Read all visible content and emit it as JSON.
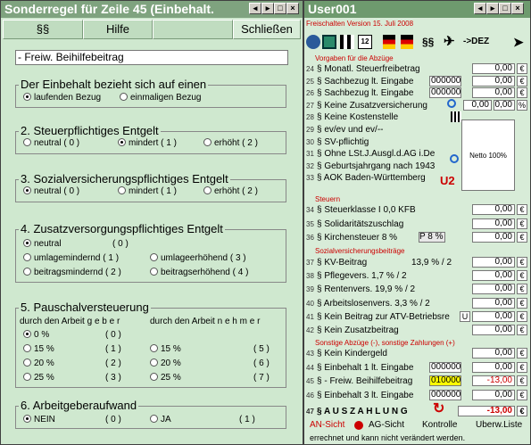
{
  "left": {
    "title": "Sonderregel für Zeile 45 (Einbehalt.",
    "menu": {
      "section": "§§",
      "help": "Hilfe",
      "close": "Schließen"
    },
    "name_field": "- Freiw. Beihilfebeitrag",
    "g1": {
      "title": "Der Einbehalt bezieht sich auf einen",
      "opt1": "laufenden Bezug",
      "opt2": "einmaligen Bezug"
    },
    "g2": {
      "title": "2. Steuerpflichtiges Entgelt",
      "opt1": "neutral",
      "v1": "( 0 )",
      "opt2": "mindert",
      "v2": "( 1 )",
      "opt3": "erhöht",
      "v3": "( 2 )"
    },
    "g3": {
      "title": "3. Sozialversicherungspflichtiges Entgelt",
      "opt1": "neutral",
      "v1": "( 0 )",
      "opt2": "mindert",
      "v2": "( 1 )",
      "opt3": "erhöht",
      "v3": "( 2 )"
    },
    "g4": {
      "title": "4. Zusatzversorgungspflichtiges Entgelt",
      "opt1": "neutral",
      "v1": "( 0 )",
      "opt2": "umlagemindernd",
      "v2": "( 1 )",
      "opt3": "umlageerhöhend",
      "v3": "( 3 )",
      "opt4": "beitragsmindernd",
      "v4": "( 2 )",
      "opt5": "beitragserhöhend",
      "v5": "( 4 )"
    },
    "g5": {
      "title": "5. Pauschalversteuerung",
      "h1": "durch den Arbeit  g e b e r",
      "h2": "durch den Arbeit  n e h m e r",
      "rows": [
        [
          "0 %",
          "( 0 )",
          "",
          ""
        ],
        [
          "15 %",
          "( 1 )",
          "15 %",
          "( 5 )"
        ],
        [
          "20 %",
          "( 2 )",
          "20 %",
          "( 6 )"
        ],
        [
          "25 %",
          "( 3 )",
          "25 %",
          "( 7 )"
        ]
      ]
    },
    "g6": {
      "title": "6. Arbeitgeberaufwand",
      "opt1": "NEIN",
      "v1": "( 0 )",
      "opt2": "JA",
      "v2": "( 1 )"
    }
  },
  "right": {
    "title": "User001",
    "subtitle": "Freischalten   Version 15. Juli 2008",
    "toolbar": {
      "sect": "§§",
      "dez": "->DEZ"
    },
    "sec1": "Vorgaben für die Abzüge",
    "rows1": [
      {
        "n": "24",
        "l": "§ Monatl. Steuerfreibetrag",
        "v": "0,00"
      },
      {
        "n": "25",
        "l": "§ Sachbezug lt. Eingabe",
        "code": "000000",
        "v": "0,00"
      },
      {
        "n": "26",
        "l": "§ Sachbezug lt. Eingabe",
        "code": "000000",
        "v": "0,00"
      },
      {
        "n": "27",
        "l": "§ Keine Zusatzversicherung",
        "v": "0,00",
        "v2": "0,00"
      },
      {
        "n": "28",
        "l": "§ Keine Kostenstelle"
      },
      {
        "n": "29",
        "l": "§ ev/ev und ev/--"
      },
      {
        "n": "30",
        "l": "§ SV-pflichtig"
      },
      {
        "n": "31",
        "l": "§ Ohne LSt.J.Ausgl.d.AG i.De"
      },
      {
        "n": "32",
        "l": "§ Geburtsjahrgang nach 1943"
      },
      {
        "n": "33",
        "l": "§ AOK Baden-Württemberg"
      }
    ],
    "netto": "Netto  100%",
    "u2": "U2",
    "sec2": "Steuern",
    "rows2": [
      {
        "n": "34",
        "l": "§ Steuerklasse I     0,0 KFB",
        "v": "0,00"
      },
      {
        "n": "35",
        "l": "§ Solidaritätszuschlag",
        "v": "0,00"
      },
      {
        "n": "36",
        "l": "§ Kirchensteuer 8 %",
        "tag": "P 8 %",
        "v": "0,00"
      }
    ],
    "sec3": "Sozialversicherungsbeiträge",
    "rows3": [
      {
        "n": "37",
        "l": "§ KV-Beitrag",
        "m": "13,9 % / 2",
        "v": "0,00"
      },
      {
        "n": "38",
        "l": "§ Pflegevers.  1,7 % / 2",
        "v": "0,00"
      },
      {
        "n": "39",
        "l": "§ Rentenvers.  19,9 % / 2",
        "v": "0,00"
      },
      {
        "n": "40",
        "l": "§ Arbeitslosenvers.  3,3 % / 2",
        "v": "0,00"
      },
      {
        "n": "41",
        "l": "§ Kein Beitrag zur ATV-Betriebsre",
        "u": "U",
        "v": "0,00"
      },
      {
        "n": "42",
        "l": "§ Kein Zusatzbeitrag",
        "v": "0,00"
      }
    ],
    "sec4": "Sonstige Abzüge (-), sonstige Zahlungen (+)",
    "rows4": [
      {
        "n": "43",
        "l": "§ Kein Kindergeld",
        "v": "0,00"
      },
      {
        "n": "44",
        "l": "§ Einbehalt 1 lt. Eingabe",
        "code": "000000",
        "v": "0,00"
      },
      {
        "n": "45",
        "l": "§ - Freiw. Beihilfebeitrag",
        "code": "010000",
        "v": "-13,00"
      },
      {
        "n": "46",
        "l": "§ Einbehalt 3 lt. Eingabe",
        "code": "000000",
        "v": "0,00"
      }
    ],
    "pay": {
      "n": "47",
      "l": "§ A U S Z A H L U N G",
      "v": "-13,00"
    },
    "cur": "€",
    "bottom": {
      "an": "AN-Sicht",
      "ag": "AG-Sicht",
      "kon": "Kontrolle",
      "uebw": "Uberw.Liste"
    },
    "status": "errechnet und kann nicht verändert werden."
  }
}
